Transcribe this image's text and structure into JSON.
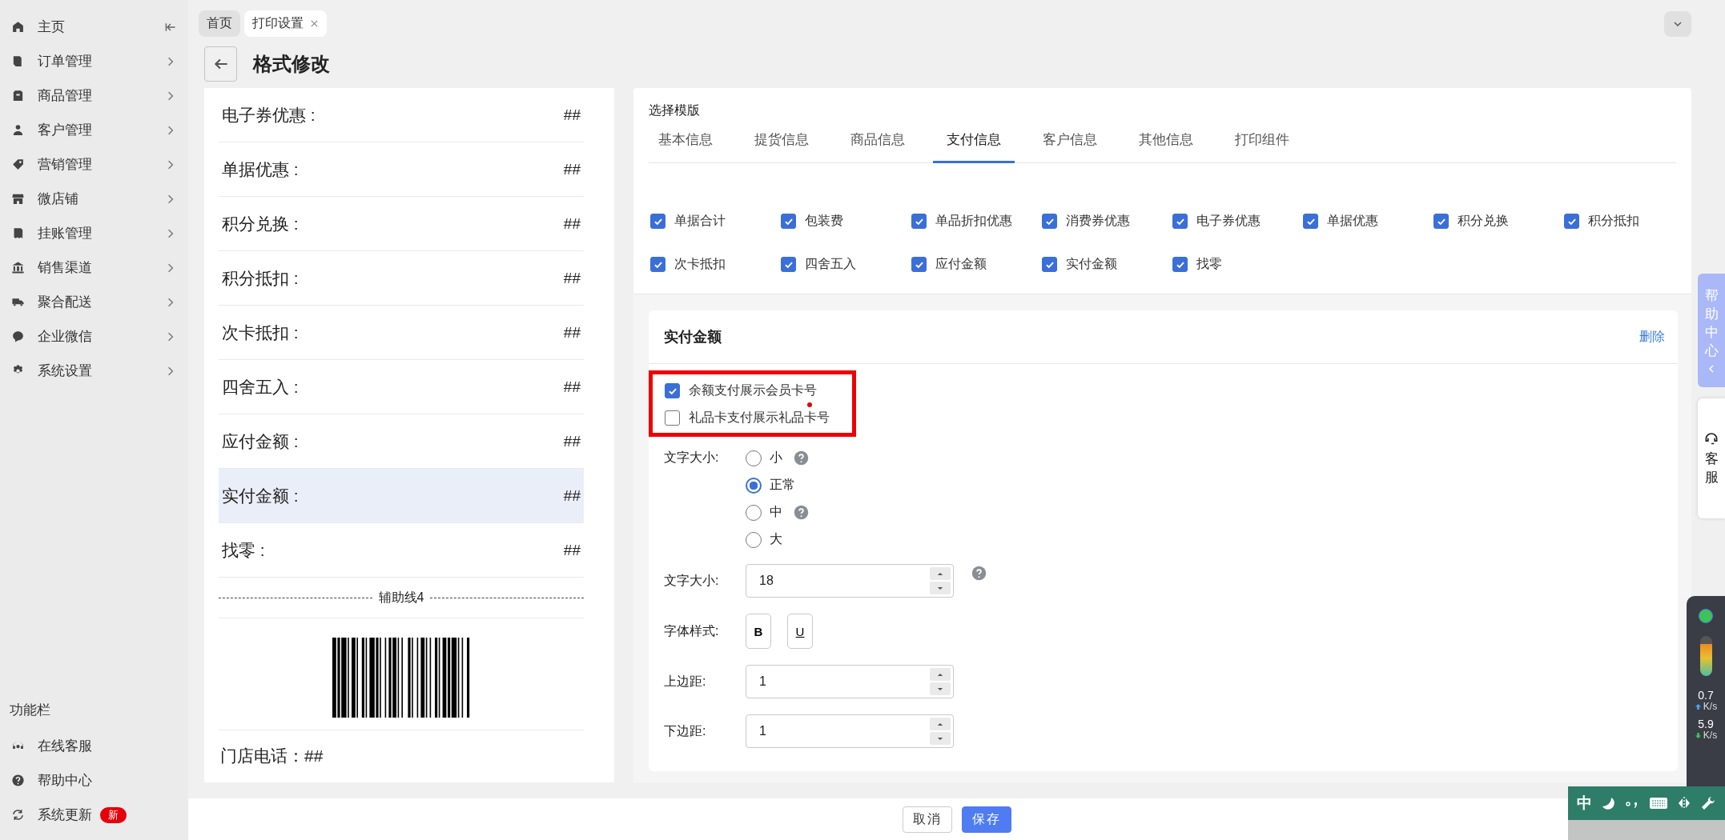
{
  "sidebar": {
    "items": [
      {
        "label": "主页",
        "kind": "collapse"
      },
      {
        "label": "订单管理",
        "kind": "menu"
      },
      {
        "label": "商品管理",
        "kind": "menu"
      },
      {
        "label": "客户管理",
        "kind": "menu"
      },
      {
        "label": "营销管理",
        "kind": "menu"
      },
      {
        "label": "微店铺",
        "kind": "menu"
      },
      {
        "label": "挂账管理",
        "kind": "menu"
      },
      {
        "label": "销售渠道",
        "kind": "menu"
      },
      {
        "label": "聚合配送",
        "kind": "menu"
      },
      {
        "label": "企业微信",
        "kind": "menu"
      },
      {
        "label": "系统设置",
        "kind": "menu"
      }
    ],
    "footer_title": "功能栏",
    "footer_items": [
      {
        "label": "在线客服"
      },
      {
        "label": "帮助中心"
      },
      {
        "label": "系统更新",
        "badge": "新"
      }
    ]
  },
  "tabs": [
    {
      "label": "首页",
      "selected": false,
      "closable": false
    },
    {
      "label": "打印设置",
      "selected": true,
      "closable": true
    }
  ],
  "page_title": "格式修改",
  "preview": {
    "rows": [
      {
        "label": "电子券优惠 :",
        "value": "##",
        "selected": false
      },
      {
        "label": "单据优惠 :",
        "value": "##",
        "selected": false
      },
      {
        "label": "积分兑换 :",
        "value": "##",
        "selected": false
      },
      {
        "label": "积分抵扣 :",
        "value": "##",
        "selected": false
      },
      {
        "label": "次卡抵扣 :",
        "value": "##",
        "selected": false
      },
      {
        "label": "四舍五入 :",
        "value": "##",
        "selected": false
      },
      {
        "label": "应付金额 :",
        "value": "##",
        "selected": false
      },
      {
        "label": "实付金额 :",
        "value": "##",
        "selected": true
      },
      {
        "label": "找零 :",
        "value": "##",
        "selected": false
      }
    ],
    "divider": "辅助线4",
    "footer": "门店电话：##"
  },
  "template": {
    "heading": "选择模版",
    "tabs": [
      {
        "label": "基本信息",
        "selected": false
      },
      {
        "label": "提货信息",
        "selected": false
      },
      {
        "label": "商品信息",
        "selected": false
      },
      {
        "label": "支付信息",
        "selected": true
      },
      {
        "label": "客户信息",
        "selected": false
      },
      {
        "label": "其他信息",
        "selected": false
      },
      {
        "label": "打印组件",
        "selected": false
      }
    ],
    "options": [
      {
        "label": "单据合计",
        "checked": true
      },
      {
        "label": "包装费",
        "checked": true
      },
      {
        "label": "单品折扣优惠",
        "checked": true
      },
      {
        "label": "消费券优惠",
        "checked": true
      },
      {
        "label": "电子券优惠",
        "checked": true
      },
      {
        "label": "单据优惠",
        "checked": true
      },
      {
        "label": "积分兑换",
        "checked": true
      },
      {
        "label": "积分抵扣",
        "checked": true
      },
      {
        "label": "次卡抵扣",
        "checked": true
      },
      {
        "label": "四舍五入",
        "checked": true
      },
      {
        "label": "应付金额",
        "checked": true
      },
      {
        "label": "实付金额",
        "checked": true
      },
      {
        "label": "找零",
        "checked": true
      }
    ]
  },
  "detail": {
    "title": "实付金额",
    "delete": "删除",
    "toggles": [
      {
        "label": "余额支付展示会员卡号",
        "checked": true
      },
      {
        "label": "礼品卡支付展示礼品卡号",
        "checked": false
      }
    ],
    "size_label": "文字大小:",
    "sizes": [
      {
        "label": "小",
        "selected": false,
        "help": true
      },
      {
        "label": "正常",
        "selected": true,
        "help": false
      },
      {
        "label": "中",
        "selected": false,
        "help": true
      },
      {
        "label": "大",
        "selected": false,
        "help": false
      }
    ],
    "font_size": {
      "label": "文字大小:",
      "value": "18"
    },
    "style": {
      "label": "字体样式:",
      "buttons": [
        {
          "label": "B",
          "kind": "bold"
        },
        {
          "label": "U",
          "kind": "underline"
        }
      ]
    },
    "margin_top": {
      "label": "上边距:",
      "value": "1"
    },
    "margin_bottom": {
      "label": "下边距:",
      "value": "1"
    }
  },
  "footer_buttons": [
    {
      "label": "取消",
      "kind": "default"
    },
    {
      "label": "保存",
      "kind": "primary"
    }
  ],
  "float": {
    "help": "帮助中心",
    "service": "客服"
  },
  "monitor": {
    "up": "0.7",
    "up_unit": "K/s",
    "down": "5.9",
    "down_unit": "K/s"
  },
  "ime": {
    "mode": "中"
  }
}
